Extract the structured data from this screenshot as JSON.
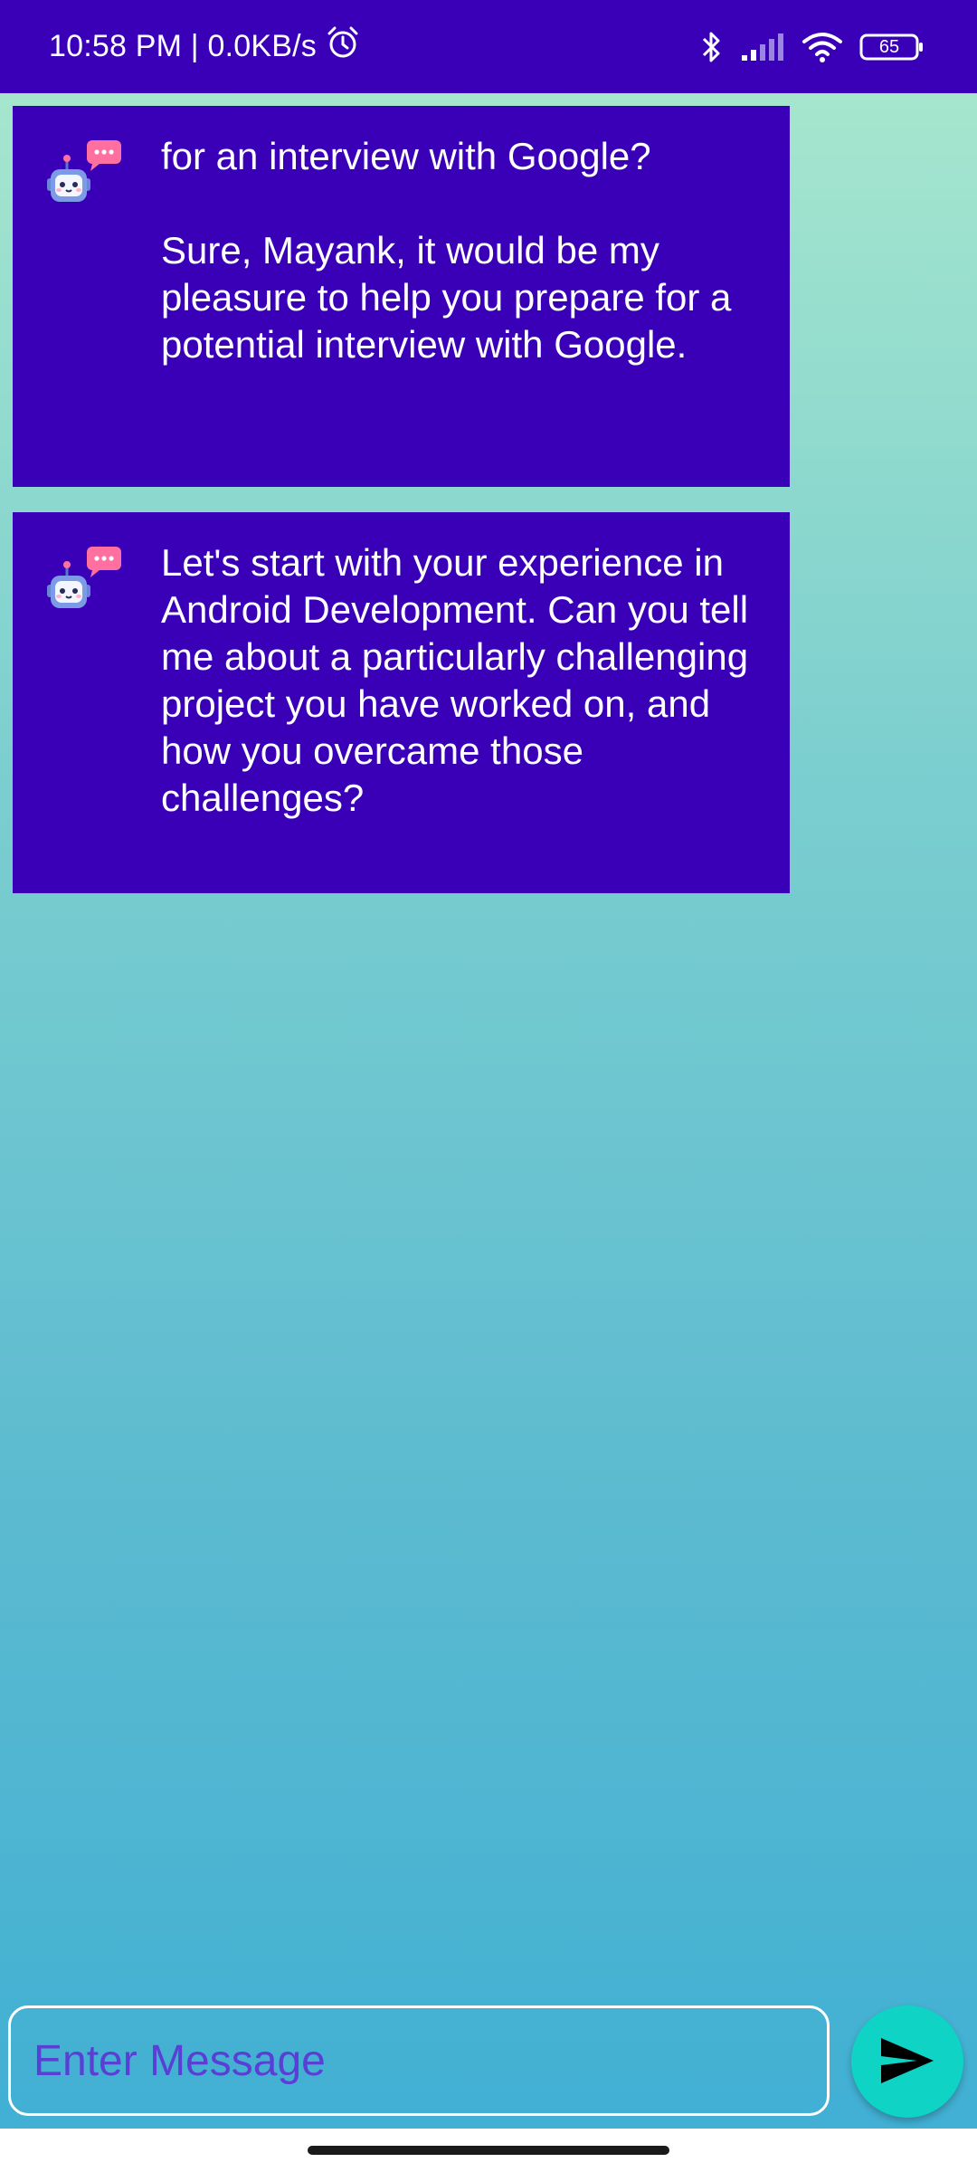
{
  "status_bar": {
    "time_network": "10:58 PM | 0.0KB/s",
    "icons": [
      "alarm-icon",
      "bluetooth-icon",
      "signal-icon",
      "wifi-icon",
      "battery-icon"
    ],
    "battery_level": "65"
  },
  "chat": {
    "messages": [
      {
        "avatar_icon": "chatbot-robot-icon",
        "text": "for an interview with Google?\n\nSure, Mayank, it would be my pleasure to help you prepare for a potential interview with Google."
      },
      {
        "avatar_icon": "chatbot-robot-icon",
        "text": "Let's start with your experience in Android Development. Can you tell me about a particularly challenging project you have worked on, and how you overcame those challenges?"
      }
    ]
  },
  "composer": {
    "placeholder": "Enter Message",
    "value": "",
    "send_icon": "send-icon"
  },
  "colors": {
    "status_bar": "#3a00b8",
    "bubble": "#3a00b8",
    "send_button": "#0fd3c4",
    "placeholder": "#5a3fd4"
  }
}
